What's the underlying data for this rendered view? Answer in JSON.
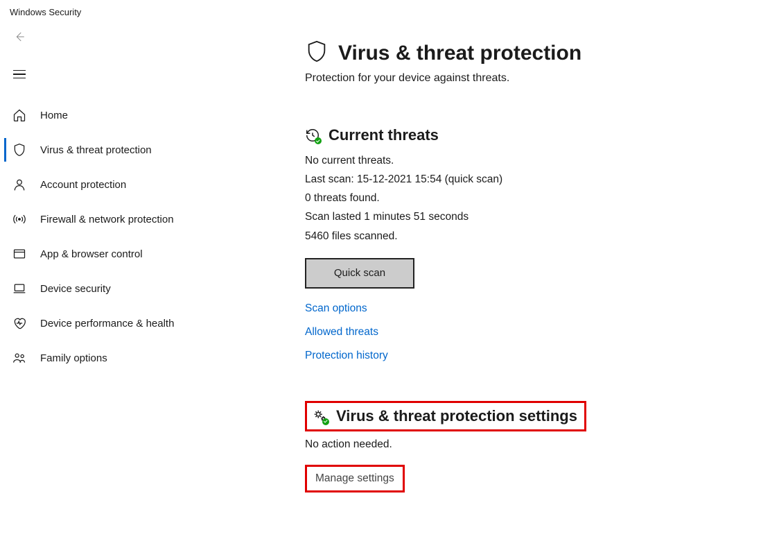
{
  "app_title": "Windows Security",
  "sidebar": {
    "items": [
      {
        "label": "Home"
      },
      {
        "label": "Virus & threat protection"
      },
      {
        "label": "Account protection"
      },
      {
        "label": "Firewall & network protection"
      },
      {
        "label": "App & browser control"
      },
      {
        "label": "Device security"
      },
      {
        "label": "Device performance & health"
      },
      {
        "label": "Family options"
      }
    ]
  },
  "page": {
    "title": "Virus & threat protection",
    "subtitle": "Protection for your device against threats."
  },
  "current_threats": {
    "title": "Current threats",
    "no_threats": "No current threats.",
    "last_scan": "Last scan: 15-12-2021 15:54 (quick scan)",
    "threats_found": "0 threats found.",
    "duration": "Scan lasted 1 minutes 51 seconds",
    "files_scanned": "5460 files scanned.",
    "quick_scan_label": "Quick scan",
    "links": {
      "scan_options": "Scan options",
      "allowed_threats": "Allowed threats",
      "protection_history": "Protection history"
    }
  },
  "settings_section": {
    "title": "Virus & threat protection settings",
    "note": "No action needed.",
    "manage_link": "Manage settings"
  }
}
